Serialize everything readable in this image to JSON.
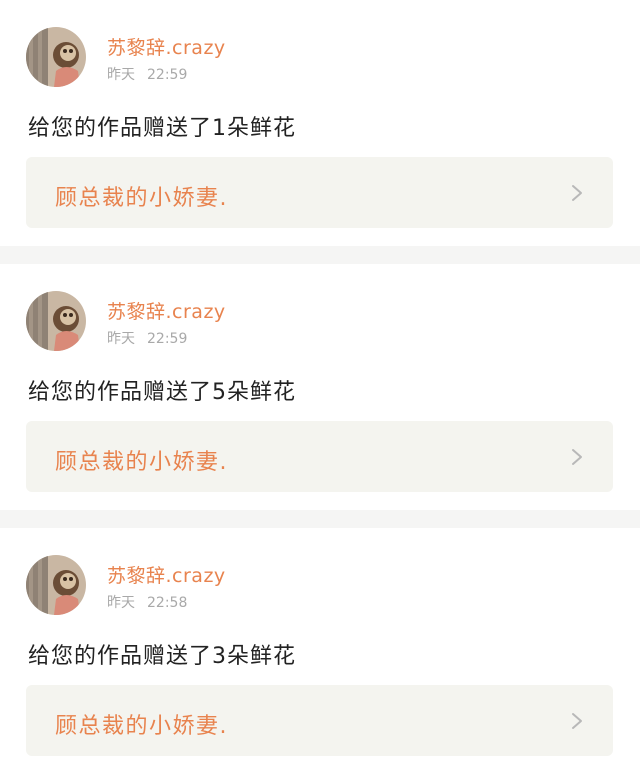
{
  "colors": {
    "accent": "#e8834e",
    "message_text": "#222222",
    "timestamp": "#a9a9a9",
    "card_link_bg": "#f4f4ef",
    "divider": "#f5f5f4"
  },
  "feed": [
    {
      "username": "苏黎辞.crazy",
      "day": "昨天",
      "time": "22:59",
      "message": "给您的作品赠送了1朵鲜花",
      "work_title": "顾总裁的小娇妻.",
      "avatar_icon": "user-avatar-icon",
      "link_icon": "chevron-right-icon"
    },
    {
      "username": "苏黎辞.crazy",
      "day": "昨天",
      "time": "22:59",
      "message": "给您的作品赠送了5朵鲜花",
      "work_title": "顾总裁的小娇妻.",
      "avatar_icon": "user-avatar-icon",
      "link_icon": "chevron-right-icon"
    },
    {
      "username": "苏黎辞.crazy",
      "day": "昨天",
      "time": "22:58",
      "message": "给您的作品赠送了3朵鲜花",
      "work_title": "顾总裁的小娇妻.",
      "avatar_icon": "user-avatar-icon",
      "link_icon": "chevron-right-icon"
    }
  ]
}
